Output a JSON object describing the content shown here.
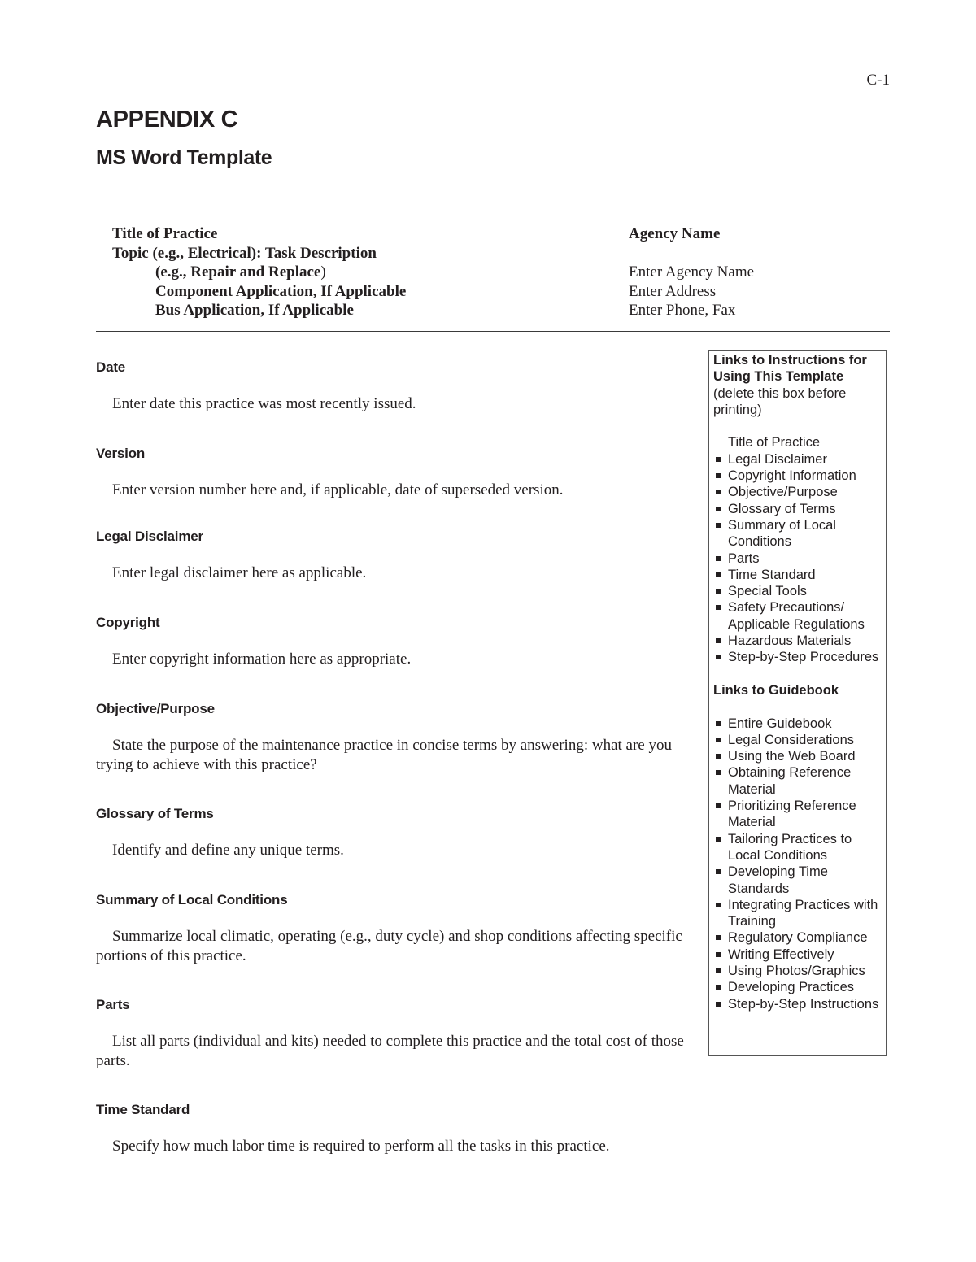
{
  "page_number": "C-1",
  "appendix": {
    "title": "APPENDIX C",
    "subtitle": "MS Word Template"
  },
  "header": {
    "left_lines": [
      "Title of Practice",
      "Topic (e.g., Electrical): Task Description",
      "(e.g., Repair and Replace",
      ")",
      "Component Application, If Applicable",
      "Bus Application, If Applicable"
    ],
    "agency_label": "Agency Name",
    "agency_fields": [
      "Enter Agency Name",
      "Enter Address",
      "Enter Phone, Fax"
    ]
  },
  "sections": [
    {
      "heading": "Date",
      "body": "Enter date this practice was most recently issued."
    },
    {
      "heading": "Version",
      "body": "Enter version number here and, if applicable, date of superseded version."
    },
    {
      "heading": "Legal Disclaimer",
      "body": "Enter legal disclaimer here as applicable."
    },
    {
      "heading": "Copyright",
      "body": "Enter copyright information here as appropriate."
    },
    {
      "heading": "Objective/Purpose",
      "body": "State the purpose of the maintenance practice in concise terms by answering: what are you trying to achieve with this practice?"
    },
    {
      "heading": "Glossary of Terms",
      "body": "Identify and define any unique terms."
    },
    {
      "heading": "Summary of Local Conditions",
      "body": "Summarize local climatic, operating (e.g., duty cycle) and shop conditions affecting specific portions of this practice."
    },
    {
      "heading": "Parts",
      "body": "List all parts (individual and kits) needed to complete this practice and the total cost of those parts."
    },
    {
      "heading": "Time Standard",
      "body": "Specify how much labor time is required to perform all the tasks in this practice."
    }
  ],
  "sidebar": {
    "title": "Links to Instructions for Using This Template",
    "note": "(delete this box before printing)",
    "instruction_links": [
      "Title of Practice",
      "Legal Disclaimer",
      "Copyright Information",
      "Objective/Purpose",
      "Glossary of Terms",
      "Summary of Local Conditions",
      "Parts",
      "Time Standard",
      "Special Tools",
      "Safety Precautions/ Applicable Regulations",
      "Hazardous Materials",
      "Step-by-Step Procedures"
    ],
    "guidebook_title": "Links to Guidebook",
    "guidebook_links": [
      "Entire Guidebook",
      "Legal Considerations",
      "Using the Web Board",
      "Obtaining Reference Material",
      "Prioritizing Reference Material",
      "Tailoring Practices to Local Conditions",
      "Developing Time Standards",
      "Integrating Practices with Training",
      "Regulatory Compliance",
      "Writing Effectively",
      "Using Photos/Graphics",
      "Developing Practices",
      "Step-by-Step Instructions"
    ]
  }
}
